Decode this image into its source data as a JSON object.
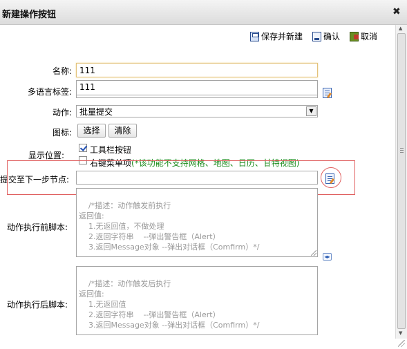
{
  "dialog": {
    "title": "新建操作按钮"
  },
  "toolbar": {
    "save_new": "保存并新建",
    "confirm": "确认",
    "cancel": "取消"
  },
  "form": {
    "name_label": "名称:",
    "name_value": "111",
    "i18n_label": "多语言标签:",
    "i18n_value": "111",
    "action_label": "动作:",
    "action_value": "批量提交",
    "icon_label": "图标:",
    "icon_select": "选择",
    "icon_clear": "清除",
    "position_label": "显示位置:",
    "pos_toolbar": "工具栏按钮",
    "pos_context": "右键菜单项",
    "pos_context_hint": "(*该功能不支持网格、地图、日历、甘特视图)",
    "next_node_label": "提交至下一步节点:",
    "next_node_value": "",
    "before_script_label": "动作执行前脚本:",
    "before_script": "/*描述：动作触发前执行\n返回值:\n    1.无返回值，不做处理\n    2.返回字符串    --弹出警告框（Alert）\n    3.返回Message对象 --弹出对话框（Comfirm）*/",
    "after_script_label": "动作执行后脚本:",
    "after_script": "/*描述：动作触发后执行\n返回值:\n    1.无返回值\n    2.返回字符串    --弹出警告框（Alert）\n    3.返回Message对象 --弹出对话框（Comfirm）*/"
  }
}
